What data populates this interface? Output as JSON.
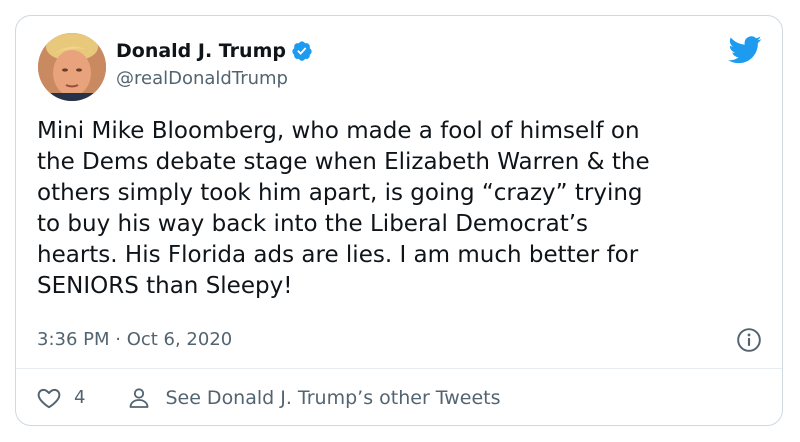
{
  "author": {
    "name": "Donald J. Trump",
    "handle": "@realDonaldTrump",
    "verified": true
  },
  "tweet": {
    "text": "Mini Mike Bloomberg, who made a fool of himself on\nthe Dems debate stage when Elizabeth Warren & the\nothers simply took him apart, is going “crazy” trying\nto buy his way back into the Liberal Democrat’s\nhearts. His Florida ads are lies. I am much better for\nSENIORS than Sleepy!",
    "timestamp": "3:36 PM · Oct 6, 2020"
  },
  "actions": {
    "like_count": "4",
    "see_others_label": "See Donald J. Trump’s other Tweets"
  },
  "icons": {
    "brand": "twitter-bird-icon",
    "verified": "verified-badge-icon",
    "info": "info-icon",
    "like": "heart-icon",
    "profile": "person-icon"
  },
  "colors": {
    "brand": "#1d9bf0",
    "text": "#0f1419",
    "secondary": "#536471",
    "border": "#cfd9de"
  }
}
